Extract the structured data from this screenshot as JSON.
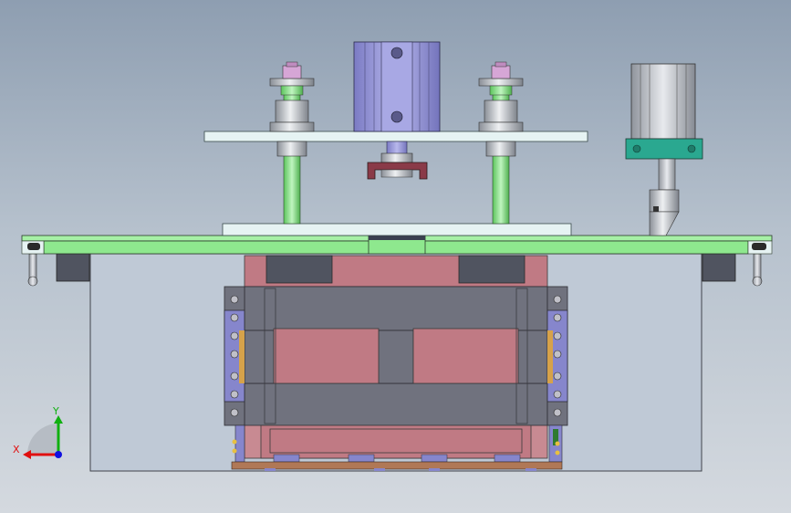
{
  "viewport": {
    "background_top": "#8e9eb1",
    "background_bottom": "#d4d9df"
  },
  "triad": {
    "x_label": "X",
    "y_label": "Y",
    "x_color": "#e01010",
    "y_color": "#10b010",
    "z_color": "#1010e0"
  },
  "colors": {
    "green_plate": "#8ee88e",
    "pale_plate": "#e6f3f3",
    "blue_cylinder": "#9898d8",
    "teal_mount": "#2aa890",
    "pink_block": "#c07a84",
    "grey_frame": "#70727e",
    "enclosure": "#bfc9d6",
    "dark_block": "#505460",
    "brown_base": "#b07856"
  }
}
